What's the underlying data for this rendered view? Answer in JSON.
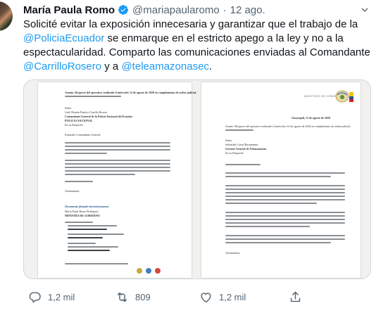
{
  "tweet": {
    "author": {
      "display_name": "María Paula Romo",
      "handle": "@mariapaularomo",
      "verified": true
    },
    "separator": "·",
    "timestamp": "12 ago.",
    "text": {
      "p1": "Solicité evitar la exposición innecesaria y garantizar que el trabajo de la ",
      "mention1": "@PoliciaEcuador",
      "p2": " se enmarque en el estricto apego a la ley y no a la espectacularidad. Comparto las comunicaciones enviadas al Comandante ",
      "mention2": "@CarrilloRosero",
      "p3": " y a ",
      "mention3": "@teleamazonasec",
      "p4": "."
    },
    "attachment": {
      "page1": {
        "asunto": "Asunto: Respecto del operativo realizado el miércoles 12 de agosto de 2020 en cumplimiento de orden judicial.",
        "to_label": "Señor",
        "to_name": "Gral. Hernán Patricio Carrillo Rosero",
        "to_title": "Comandante General de la Policía Nacional del Ecuador",
        "to_org": "POLICIA NACIONAL",
        "to_city": "En su Despacho",
        "greeting": "Estimado Comandante General:",
        "closing": "Atentamente,",
        "signed": "Documento firmado electrónicamente",
        "signer": "María Paula Romo Rodríguez",
        "signer_title": "MINISTRA DE GOBIERNO"
      },
      "page2": {
        "ministry": "MINISTERIO DE GOBIERNO",
        "date": "Guayaquil, 12 de agosto de 2020",
        "asunto": "Asunto: Respecto del operativo realizado el miércoles 12 de agosto de 2020 en cumplimiento de orden judicial.",
        "to_label": "Señor",
        "to_name": "Sebastián Corral Bustamante",
        "to_title": "Gerente General de Teleamazonas",
        "to_city": "En su Despacho",
        "closing": "Atentamente,"
      }
    },
    "actions": {
      "reply_count": "1,2 mil",
      "retweet_count": "809",
      "like_count": "1,2 mil"
    }
  },
  "colors": {
    "link": "#1d9bf0",
    "verified": "#1d9bf0",
    "muted": "#536471",
    "text": "#0f1419"
  },
  "icons": [
    "avatar",
    "verified-badge-icon",
    "chevron-down-icon",
    "reply-icon",
    "retweet-icon",
    "like-icon",
    "share-icon"
  ]
}
